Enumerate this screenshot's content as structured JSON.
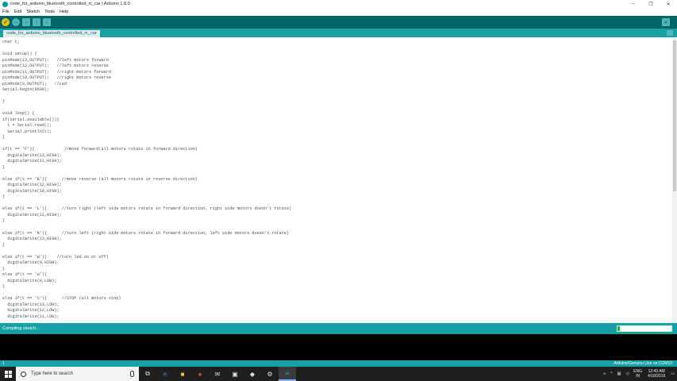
{
  "window": {
    "title": "code_for_arduino_bluetooth_controlled_rc_car | Arduino 1.8.0",
    "minimize": "–",
    "maximize": "❐",
    "close": "✕"
  },
  "menu": [
    "File",
    "Edit",
    "Sketch",
    "Tools",
    "Help"
  ],
  "toolbar": {
    "verify_icon": "check-icon",
    "upload_icon": "arrow-right-icon",
    "new_icon": "new-file-icon",
    "open_icon": "arrow-up-icon",
    "save_icon": "arrow-down-icon",
    "serial_icon": "magnifier-icon"
  },
  "tab": {
    "label": "code_for_arduino_bluetooth_controlled_rc_car"
  },
  "code": "char t;\n\nvoid setup() {\npinMode(13,OUTPUT);   //left motors forward\npinMode(12,OUTPUT);   //left motors reverse\npinMode(11,OUTPUT);   //right motors forward\npinMode(10,OUTPUT);   //right motors reverse\npinMode(9,OUTPUT);   //Led\nSerial.begin(9600);\n\n}\n\nvoid loop() {\nif(Serial.available()){\n  t = Serial.read();\n  Serial.println(t);\n}\n\nif(t == 'F'){            //move forward(all motors rotate in forward direction)\n  digitalWrite(13,HIGH);\n  digitalWrite(11,HIGH);\n}\n\nelse if(t == 'B'){      //move reverse (all motors rotate in reverse direction)\n  digitalWrite(12,HIGH);\n  digitalWrite(10,HIGH);\n}\n\nelse if(t == 'L'){      //turn right (left side motors rotate in forward direction, right side motors doesn't rotate)\n  digitalWrite(11,HIGH);\n}\n\nelse if(t == 'R'){      //turn left (right side motors rotate in forward direction, left side motors doesn't rotate)\n  digitalWrite(13,HIGH);\n}\n\nelse if(t == 'W'){    //turn led on or off)\n  digitalWrite(9,HIGH);\n}\nelse if(t == 'w'){\n  digitalWrite(9,LOW);\n}\n\nelse if(t == 'S'){      //STOP (all motors stop)\n  digitalWrite(13,LOW);\n  digitalWrite(12,LOW);\n  digitalWrite(11,LOW);",
  "status": {
    "text": "Compiling sketch...",
    "progress": 0.05
  },
  "footer": {
    "line": "1",
    "board": "Arduino/Genuino Uno on COM10"
  },
  "taskbar": {
    "search_placeholder": "Type here to search",
    "apps": [
      "task-view-icon",
      "edge-icon",
      "file-explorer-icon",
      "chrome-icon",
      "mail-icon",
      "store-icon",
      "app-icon",
      "settings-icon",
      "arduino-icon"
    ],
    "lang": "ENG",
    "region": "IN",
    "time": "12:43 AM",
    "date": "4/18/2019"
  },
  "colors": {
    "toolbar": "#006468",
    "tabbar": "#17a1a5",
    "accent": "#00979c",
    "progress": "#15c23d"
  }
}
